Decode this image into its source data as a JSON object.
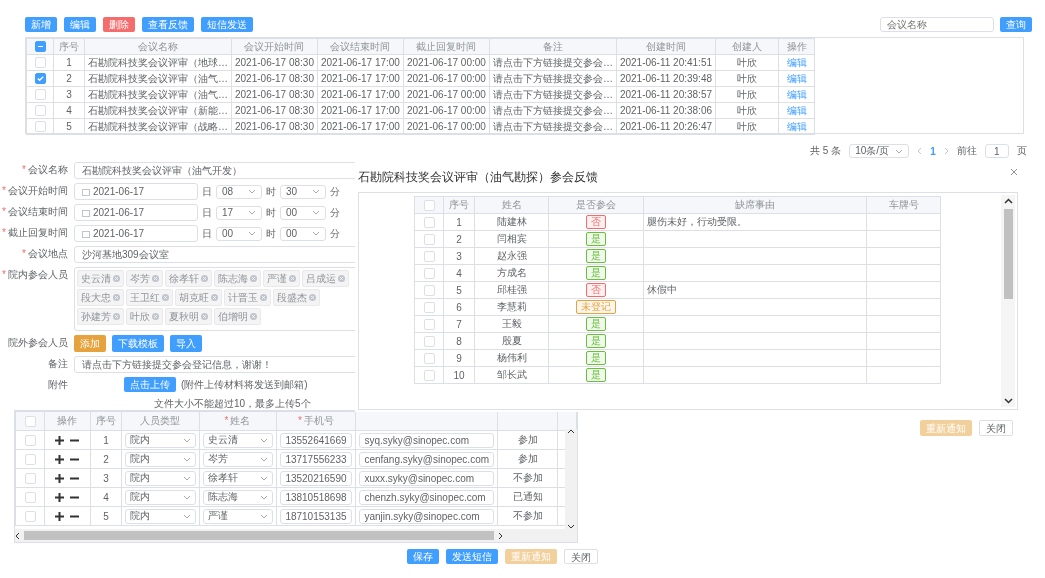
{
  "toolbar": {
    "buttons": [
      {
        "label": "新增",
        "kind": "primary"
      },
      {
        "label": "编辑",
        "kind": "primary"
      },
      {
        "label": "删除",
        "kind": "danger"
      },
      {
        "label": "查看反馈",
        "kind": "primary"
      },
      {
        "label": "短信发送",
        "kind": "primary"
      }
    ]
  },
  "search": {
    "placeholder": "会议名称",
    "button": "查询"
  },
  "meetings": {
    "all_indeterminate": true,
    "columns": [
      "序号",
      "会议名称",
      "会议开始时间",
      "会议结束时间",
      "截止回复时间",
      "备注",
      "创建时间",
      "创建人",
      "操作"
    ],
    "rows": [
      {
        "selected": false,
        "cells": [
          "1",
          "石勘院科技奖会议评审（地球…",
          "2021-06-17 08:30",
          "2021-06-17 17:00",
          "2021-06-17 00:00",
          "请点击下方链接提交参会…",
          "2021-06-11 20:41:51",
          "叶欣"
        ],
        "action": "编辑"
      },
      {
        "selected": true,
        "cells": [
          "2",
          "石勘院科技奖会议评审（油气…",
          "2021-06-17 08:30",
          "2021-06-17 17:00",
          "2021-06-17 00:00",
          "请点击下方链接提交参会…",
          "2021-06-11 20:39:48",
          "叶欣"
        ],
        "action": "编辑"
      },
      {
        "selected": false,
        "cells": [
          "3",
          "石勘院科技奖会议评审（油气…",
          "2021-06-17 08:30",
          "2021-06-17 17:00",
          "2021-06-17 00:00",
          "请点击下方链接提交参会…",
          "2021-06-11 20:38:57",
          "叶欣"
        ],
        "action": "编辑"
      },
      {
        "selected": false,
        "cells": [
          "4",
          "石勘院科技奖会议评审（新能…",
          "2021-06-17 08:30",
          "2021-06-17 17:00",
          "2021-06-17 00:00",
          "请点击下方链接提交参会…",
          "2021-06-11 20:38:06",
          "叶欣"
        ],
        "action": "编辑"
      },
      {
        "selected": false,
        "cells": [
          "5",
          "石勘院科技奖会议评审（战略…",
          "2021-06-17 08:30",
          "2021-06-17 17:00",
          "2021-06-17 00:00",
          "请点击下方链接提交参会…",
          "2021-06-11 20:26:47",
          "叶欣"
        ],
        "action": "编辑"
      }
    ]
  },
  "pagination": {
    "total": "共 5 条",
    "page_size": "10条/页",
    "pages": [
      {
        "label": "1",
        "selected": true
      }
    ],
    "goto_label": "前往",
    "goto_value": "1",
    "page_suffix": "页"
  },
  "form": {
    "fields": [
      {
        "kind": "text",
        "label": "会议名称",
        "marker": "*",
        "value": "石勘院科技奖会议评审（油气开发）"
      },
      {
        "kind": "datetime",
        "label": "会议开始时间",
        "marker": "*",
        "date": "2021-06-17",
        "day_unit": "日",
        "hour": "08",
        "hour_unit": "时",
        "minute": "30",
        "minute_unit": "分"
      },
      {
        "kind": "datetime",
        "label": "会议结束时间",
        "marker": "*",
        "date": "2021-06-17",
        "day_unit": "日",
        "hour": "17",
        "hour_unit": "时",
        "minute": "00",
        "minute_unit": "分"
      },
      {
        "kind": "datetime",
        "label": "截止回复时间",
        "marker": "*",
        "date": "2021-06-17",
        "day_unit": "日",
        "hour": "00",
        "hour_unit": "时",
        "minute": "00",
        "minute_unit": "分"
      },
      {
        "kind": "text",
        "label": "会议地点",
        "marker": "*",
        "value": "沙河基地309会议室"
      },
      {
        "kind": "tags",
        "label": "院内参会人员",
        "marker": "*",
        "tags": [
          "史云清",
          "岑芳",
          "徐孝轩",
          "陈志海",
          "严谨",
          "吕成运",
          "段大忠",
          "王卫红",
          "胡克旺",
          "计晋玉",
          "段盛杰",
          "孙建芳",
          "叶欣",
          "夏秋明",
          "伯增明"
        ]
      },
      {
        "kind": "buttons",
        "label": "院外参会人员",
        "buttons": [
          {
            "label": "添加",
            "kind": "warning"
          },
          {
            "label": "下载模板",
            "kind": "primary"
          },
          {
            "label": "导入",
            "kind": "primary"
          }
        ]
      },
      {
        "kind": "text",
        "label": "备注",
        "value": "请点击下方链接提交参会登记信息，谢谢！"
      },
      {
        "kind": "upload",
        "label": "附件",
        "button": "点击上传",
        "note": "(附件上传材料将发送到邮箱)",
        "hint": "文件大小不能超过10，最多上传5个"
      }
    ]
  },
  "feedback_dialog": {
    "title": "石勘院科技奖会议评审（油气勘探）参会反馈",
    "all_checked": false,
    "columns": [
      "序号",
      "姓名",
      "是否参会",
      "缺席事由",
      "车牌号"
    ],
    "rows": [
      {
        "selected": false,
        "index": "1",
        "name": "陆建林",
        "attendance": {
          "label": "否",
          "color": "#f56c6c"
        },
        "reason": "腿伤未好，行动受限。"
      },
      {
        "selected": false,
        "index": "2",
        "name": "闫相宾",
        "attendance": {
          "label": "是",
          "color": "#67c23a"
        }
      },
      {
        "selected": false,
        "index": "3",
        "name": "赵永强",
        "attendance": {
          "label": "是",
          "color": "#67c23a"
        }
      },
      {
        "selected": false,
        "index": "4",
        "name": "方成名",
        "attendance": {
          "label": "是",
          "color": "#67c23a"
        }
      },
      {
        "selected": false,
        "index": "5",
        "name": "邱桂强",
        "attendance": {
          "label": "否",
          "color": "#f56c6c"
        },
        "reason": "休假中"
      },
      {
        "selected": false,
        "index": "6",
        "name": "李慧莉",
        "attendance": {
          "label": "未登记",
          "color": "#e6a23c"
        }
      },
      {
        "selected": false,
        "index": "7",
        "name": "王毅",
        "attendance": {
          "label": "是",
          "color": "#67c23a"
        }
      },
      {
        "selected": false,
        "index": "8",
        "name": "殷夏",
        "attendance": {
          "label": "是",
          "color": "#67c23a"
        }
      },
      {
        "selected": false,
        "index": "9",
        "name": "杨伟利",
        "attendance": {
          "label": "是",
          "color": "#67c23a"
        }
      },
      {
        "selected": false,
        "index": "10",
        "name": "邹长武",
        "attendance": {
          "label": "是",
          "color": "#67c23a"
        }
      }
    ],
    "buttons": [
      {
        "label": "重新通知",
        "kind": "warning",
        "disabled": true
      },
      {
        "label": "关闭",
        "kind": "plain"
      }
    ]
  },
  "participants": {
    "all_checked": false,
    "columns": [
      {
        "label": "操作"
      },
      {
        "label": "序号"
      },
      {
        "label": "人员类型"
      },
      {
        "label": "姓名",
        "marker": "*"
      },
      {
        "label": "手机号",
        "marker": "*"
      }
    ],
    "rows": [
      {
        "selected": false,
        "index": "1",
        "type": "院内",
        "name": "史云清",
        "phone": "13552641669",
        "email": "syq.syky@sinopec.com",
        "status": "参加"
      },
      {
        "selected": false,
        "index": "2",
        "type": "院内",
        "name": "岑芳",
        "phone": "13717556233",
        "email": "cenfang.syky@sinopec.com",
        "status": "参加"
      },
      {
        "selected": false,
        "index": "3",
        "type": "院内",
        "name": "徐孝轩",
        "phone": "13520216590",
        "email": "xuxx.syky@sinopec.com",
        "status": "不参加"
      },
      {
        "selected": false,
        "index": "4",
        "type": "院内",
        "name": "陈志海",
        "phone": "13810518698",
        "email": "chenzh.syky@sinopec.com",
        "status": "已通知"
      },
      {
        "selected": false,
        "index": "5",
        "type": "院内",
        "name": "严谨",
        "phone": "18710153135",
        "email": "yanjin.syky@sinopec.com",
        "status": "不参加"
      }
    ]
  },
  "footer_buttons": [
    {
      "label": "保存",
      "kind": "primary"
    },
    {
      "label": "发送短信",
      "kind": "primary"
    },
    {
      "label": "重新通知",
      "kind": "warning",
      "disabled": true
    },
    {
      "label": "关闭",
      "kind": "plain"
    }
  ]
}
